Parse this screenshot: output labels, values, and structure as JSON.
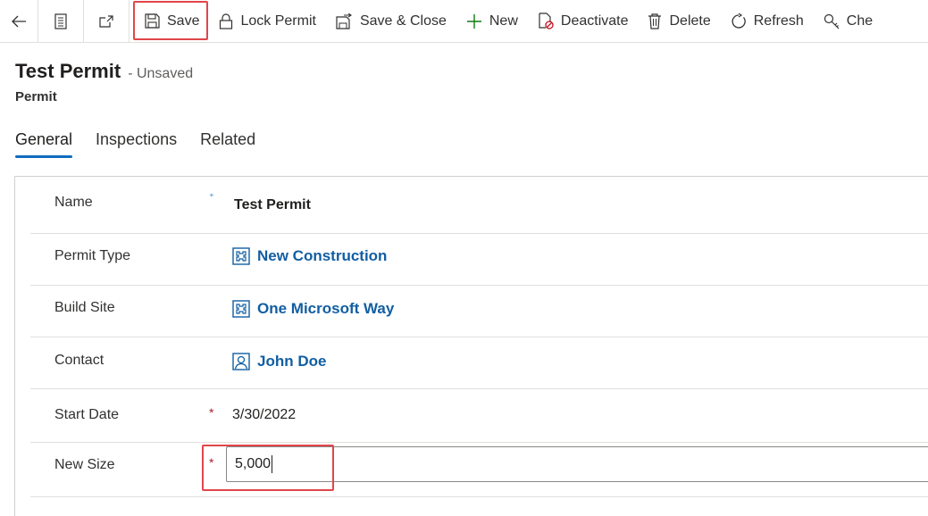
{
  "toolbar": {
    "back_icon": "back-arrow-icon",
    "form_icon": "form-icon",
    "popout_icon": "popout-icon",
    "buttons": [
      {
        "label": "Save",
        "icon": "save-icon"
      },
      {
        "label": "Lock Permit",
        "icon": "lock-icon"
      },
      {
        "label": "Save & Close",
        "icon": "save-close-icon"
      },
      {
        "label": "New",
        "icon": "plus-icon"
      },
      {
        "label": "Deactivate",
        "icon": "deactivate-icon"
      },
      {
        "label": "Delete",
        "icon": "trash-icon"
      },
      {
        "label": "Refresh",
        "icon": "refresh-icon"
      },
      {
        "label": "Che",
        "icon": "key-icon"
      }
    ]
  },
  "header": {
    "title": "Test Permit",
    "status": "- Unsaved",
    "entity": "Permit"
  },
  "tabs": [
    {
      "label": "General",
      "active": true
    },
    {
      "label": "Inspections",
      "active": false
    },
    {
      "label": "Related",
      "active": false
    }
  ],
  "form": {
    "name": {
      "label": "Name",
      "required_mark": "⁺",
      "value": "Test Permit"
    },
    "permit_type": {
      "label": "Permit Type",
      "value": "New Construction",
      "icon": "entity-record-icon"
    },
    "build_site": {
      "label": "Build Site",
      "value": "One Microsoft Way",
      "icon": "entity-record-icon"
    },
    "contact": {
      "label": "Contact",
      "value": "John Doe",
      "icon": "contact-icon"
    },
    "start_date": {
      "label": "Start Date",
      "required_mark": "*",
      "value": "3/30/2022"
    },
    "new_size": {
      "label": "New Size",
      "required_mark": "*",
      "value": "5,000"
    }
  },
  "colors": {
    "accent": "#0f6cbd",
    "link": "#115ea3",
    "required": "#a4262c",
    "highlight": "#e0464a"
  }
}
